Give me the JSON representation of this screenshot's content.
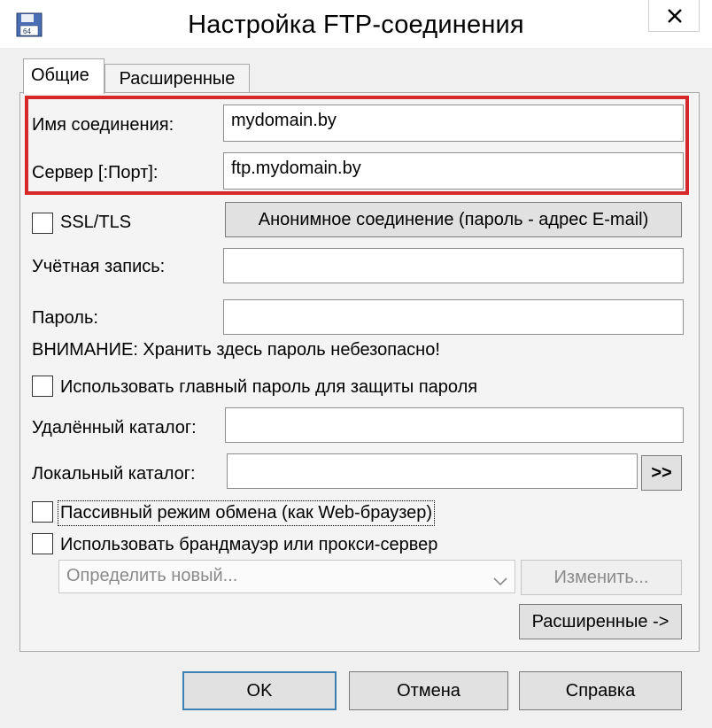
{
  "window": {
    "title": "Настройка FTP-соединения"
  },
  "tabs": [
    {
      "label": "Общие"
    },
    {
      "label": "Расширенные"
    }
  ],
  "form": {
    "connection_name": {
      "label": "Имя соединения:",
      "value": "mydomain.by"
    },
    "server": {
      "label": "Сервер [:Порт]:",
      "value": "ftp.mydomain.by"
    },
    "ssl": {
      "label": "SSL/TLS"
    },
    "anonymous_button": "Анонимное соединение (пароль - адрес E-mail)",
    "account": {
      "label": "Учётная запись:",
      "value": ""
    },
    "password": {
      "label": "Пароль:",
      "value": ""
    },
    "warning": "ВНИМАНИЕ: Хранить здесь пароль небезопасно!",
    "master_password": {
      "label": "Использовать главный пароль для защиты пароля"
    },
    "remote_dir": {
      "label": "Удалённый каталог:",
      "value": ""
    },
    "local_dir": {
      "label": "Локальный каталог:",
      "value": "",
      "browse": ">>"
    },
    "passive_mode": {
      "label": "Пассивный режим обмена (как Web-браузер)"
    },
    "firewall": {
      "label": "Использовать брандмауэр или прокси-сервер"
    },
    "proxy_select": {
      "value": "Определить новый..."
    },
    "edit_button": "Изменить...",
    "advanced_button": "Расширенные ->"
  },
  "footer": {
    "ok": "OK",
    "cancel": "Отмена",
    "help": "Справка"
  }
}
